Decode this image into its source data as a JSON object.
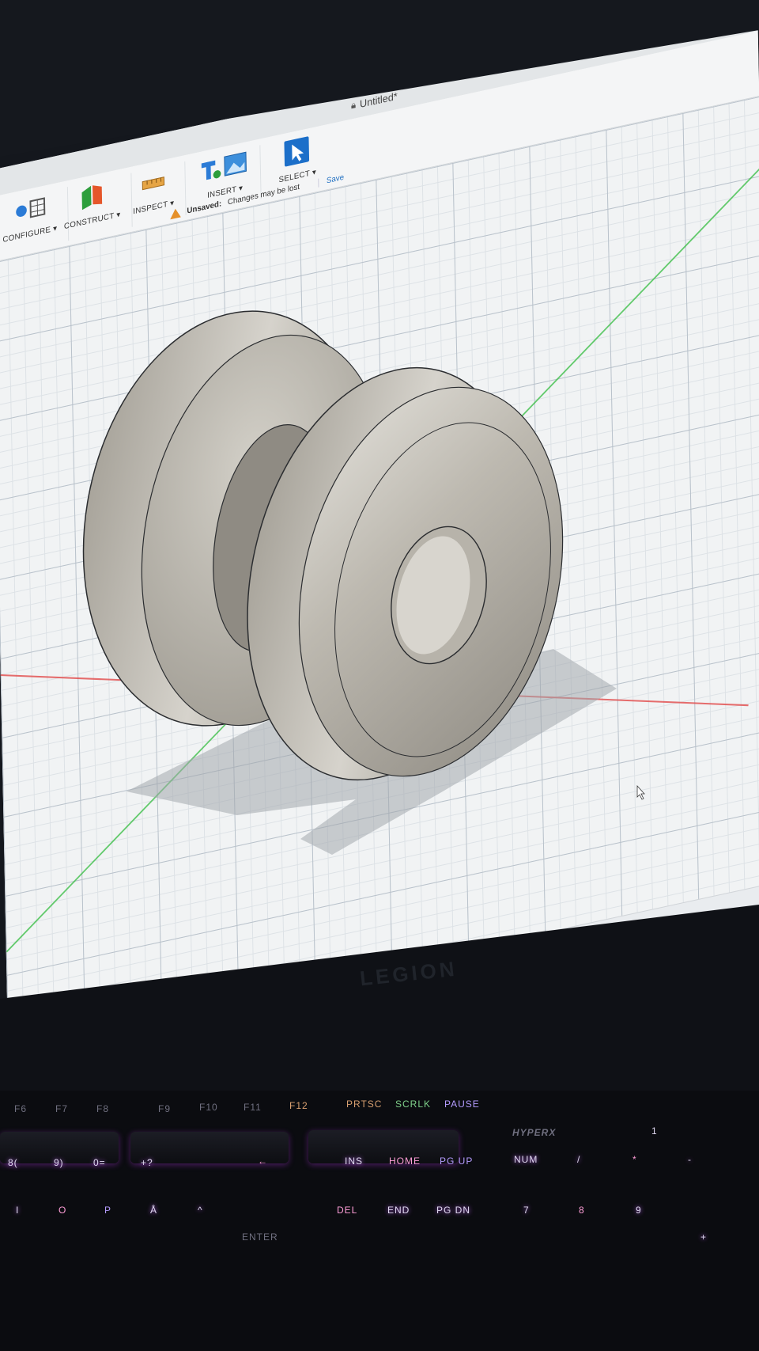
{
  "window": {
    "document_title": "Untitled*"
  },
  "toolbar": {
    "groups": [
      {
        "label": "CONFIGURE ▾",
        "icon": "configure-icon"
      },
      {
        "label": "CONSTRUCT ▾",
        "icon": "construct-plane-icon"
      },
      {
        "label": "INSPECT ▾",
        "icon": "measure-ruler-icon"
      },
      {
        "label": "INSERT ▾",
        "icon": "insert-image-icon"
      },
      {
        "label": "SELECT ▾",
        "icon": "select-cursor-icon"
      }
    ]
  },
  "status": {
    "unsaved_label": "Unsaved:",
    "message": "Changes may be lost",
    "save_label": "Save"
  },
  "navbar": {
    "icons": [
      "orbit-icon",
      "look-at-icon",
      "pan-icon",
      "zoom-window-icon",
      "zoom-fit-icon",
      "display-settings-icon",
      "grid-settings-icon",
      "viewports-icon"
    ]
  },
  "taskbar": {
    "apps": [
      "windows-start-icon",
      "file-explorer-icon",
      "chrome-icon",
      "outlook-icon",
      "discord-icon",
      "steam-icon",
      "terminal-icon",
      "fusion-icon",
      "defender-icon"
    ]
  },
  "bezel": {
    "brand": "LEGION"
  },
  "keyboard": {
    "fn_row": [
      "F6",
      "F7",
      "F8",
      "F9",
      "F10",
      "F11",
      "F12",
      "PRTSC",
      "SCRLK",
      "PAUSE"
    ],
    "brand": "HYPERX",
    "number_row": [
      "8(",
      "9)",
      "0=",
      "+?",
      "←"
    ],
    "nav_row1": [
      "INS",
      "HOME",
      "PG UP",
      "NUM",
      "/",
      "*",
      "-"
    ],
    "nav_row2": [
      "DEL",
      "END",
      "PG DN",
      "7",
      "8",
      "9",
      "+"
    ],
    "letter_row": [
      "I",
      "O",
      "P",
      "Å",
      "^",
      "ENTER"
    ],
    "misc": [
      "1"
    ]
  }
}
